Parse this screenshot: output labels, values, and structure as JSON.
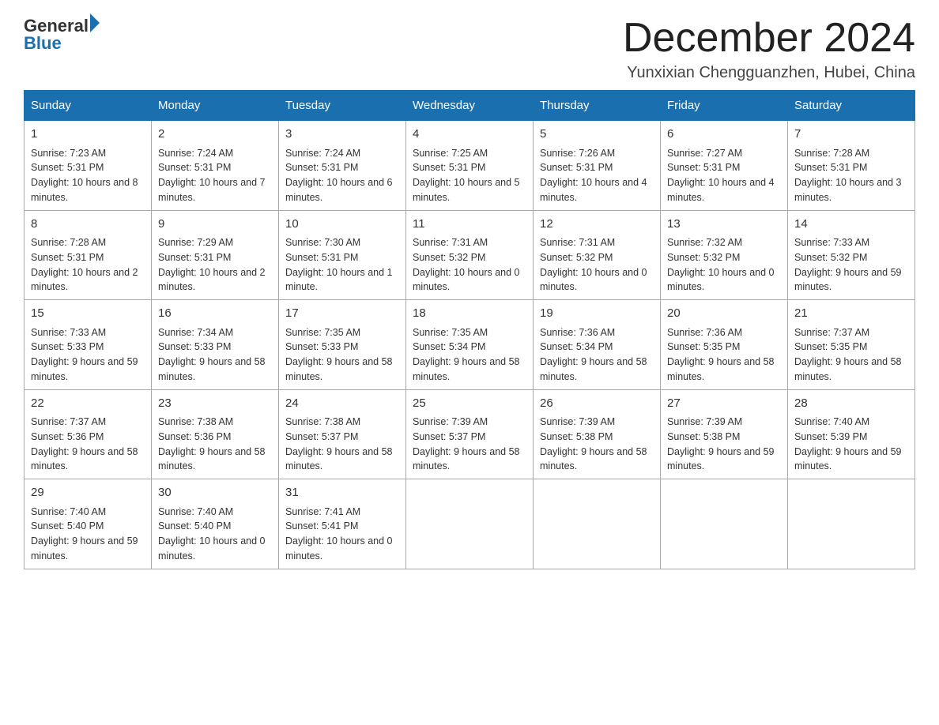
{
  "header": {
    "logo_general": "General",
    "logo_blue": "Blue",
    "month_title": "December 2024",
    "location": "Yunxixian Chengguanzhen, Hubei, China"
  },
  "days_of_week": [
    "Sunday",
    "Monday",
    "Tuesday",
    "Wednesday",
    "Thursday",
    "Friday",
    "Saturday"
  ],
  "weeks": [
    [
      {
        "day": "1",
        "sunrise": "7:23 AM",
        "sunset": "5:31 PM",
        "daylight": "10 hours and 8 minutes."
      },
      {
        "day": "2",
        "sunrise": "7:24 AM",
        "sunset": "5:31 PM",
        "daylight": "10 hours and 7 minutes."
      },
      {
        "day": "3",
        "sunrise": "7:24 AM",
        "sunset": "5:31 PM",
        "daylight": "10 hours and 6 minutes."
      },
      {
        "day": "4",
        "sunrise": "7:25 AM",
        "sunset": "5:31 PM",
        "daylight": "10 hours and 5 minutes."
      },
      {
        "day": "5",
        "sunrise": "7:26 AM",
        "sunset": "5:31 PM",
        "daylight": "10 hours and 4 minutes."
      },
      {
        "day": "6",
        "sunrise": "7:27 AM",
        "sunset": "5:31 PM",
        "daylight": "10 hours and 4 minutes."
      },
      {
        "day": "7",
        "sunrise": "7:28 AM",
        "sunset": "5:31 PM",
        "daylight": "10 hours and 3 minutes."
      }
    ],
    [
      {
        "day": "8",
        "sunrise": "7:28 AM",
        "sunset": "5:31 PM",
        "daylight": "10 hours and 2 minutes."
      },
      {
        "day": "9",
        "sunrise": "7:29 AM",
        "sunset": "5:31 PM",
        "daylight": "10 hours and 2 minutes."
      },
      {
        "day": "10",
        "sunrise": "7:30 AM",
        "sunset": "5:31 PM",
        "daylight": "10 hours and 1 minute."
      },
      {
        "day": "11",
        "sunrise": "7:31 AM",
        "sunset": "5:32 PM",
        "daylight": "10 hours and 0 minutes."
      },
      {
        "day": "12",
        "sunrise": "7:31 AM",
        "sunset": "5:32 PM",
        "daylight": "10 hours and 0 minutes."
      },
      {
        "day": "13",
        "sunrise": "7:32 AM",
        "sunset": "5:32 PM",
        "daylight": "10 hours and 0 minutes."
      },
      {
        "day": "14",
        "sunrise": "7:33 AM",
        "sunset": "5:32 PM",
        "daylight": "9 hours and 59 minutes."
      }
    ],
    [
      {
        "day": "15",
        "sunrise": "7:33 AM",
        "sunset": "5:33 PM",
        "daylight": "9 hours and 59 minutes."
      },
      {
        "day": "16",
        "sunrise": "7:34 AM",
        "sunset": "5:33 PM",
        "daylight": "9 hours and 58 minutes."
      },
      {
        "day": "17",
        "sunrise": "7:35 AM",
        "sunset": "5:33 PM",
        "daylight": "9 hours and 58 minutes."
      },
      {
        "day": "18",
        "sunrise": "7:35 AM",
        "sunset": "5:34 PM",
        "daylight": "9 hours and 58 minutes."
      },
      {
        "day": "19",
        "sunrise": "7:36 AM",
        "sunset": "5:34 PM",
        "daylight": "9 hours and 58 minutes."
      },
      {
        "day": "20",
        "sunrise": "7:36 AM",
        "sunset": "5:35 PM",
        "daylight": "9 hours and 58 minutes."
      },
      {
        "day": "21",
        "sunrise": "7:37 AM",
        "sunset": "5:35 PM",
        "daylight": "9 hours and 58 minutes."
      }
    ],
    [
      {
        "day": "22",
        "sunrise": "7:37 AM",
        "sunset": "5:36 PM",
        "daylight": "9 hours and 58 minutes."
      },
      {
        "day": "23",
        "sunrise": "7:38 AM",
        "sunset": "5:36 PM",
        "daylight": "9 hours and 58 minutes."
      },
      {
        "day": "24",
        "sunrise": "7:38 AM",
        "sunset": "5:37 PM",
        "daylight": "9 hours and 58 minutes."
      },
      {
        "day": "25",
        "sunrise": "7:39 AM",
        "sunset": "5:37 PM",
        "daylight": "9 hours and 58 minutes."
      },
      {
        "day": "26",
        "sunrise": "7:39 AM",
        "sunset": "5:38 PM",
        "daylight": "9 hours and 58 minutes."
      },
      {
        "day": "27",
        "sunrise": "7:39 AM",
        "sunset": "5:38 PM",
        "daylight": "9 hours and 59 minutes."
      },
      {
        "day": "28",
        "sunrise": "7:40 AM",
        "sunset": "5:39 PM",
        "daylight": "9 hours and 59 minutes."
      }
    ],
    [
      {
        "day": "29",
        "sunrise": "7:40 AM",
        "sunset": "5:40 PM",
        "daylight": "9 hours and 59 minutes."
      },
      {
        "day": "30",
        "sunrise": "7:40 AM",
        "sunset": "5:40 PM",
        "daylight": "10 hours and 0 minutes."
      },
      {
        "day": "31",
        "sunrise": "7:41 AM",
        "sunset": "5:41 PM",
        "daylight": "10 hours and 0 minutes."
      },
      null,
      null,
      null,
      null
    ]
  ],
  "labels": {
    "sunrise": "Sunrise:",
    "sunset": "Sunset:",
    "daylight": "Daylight:"
  }
}
